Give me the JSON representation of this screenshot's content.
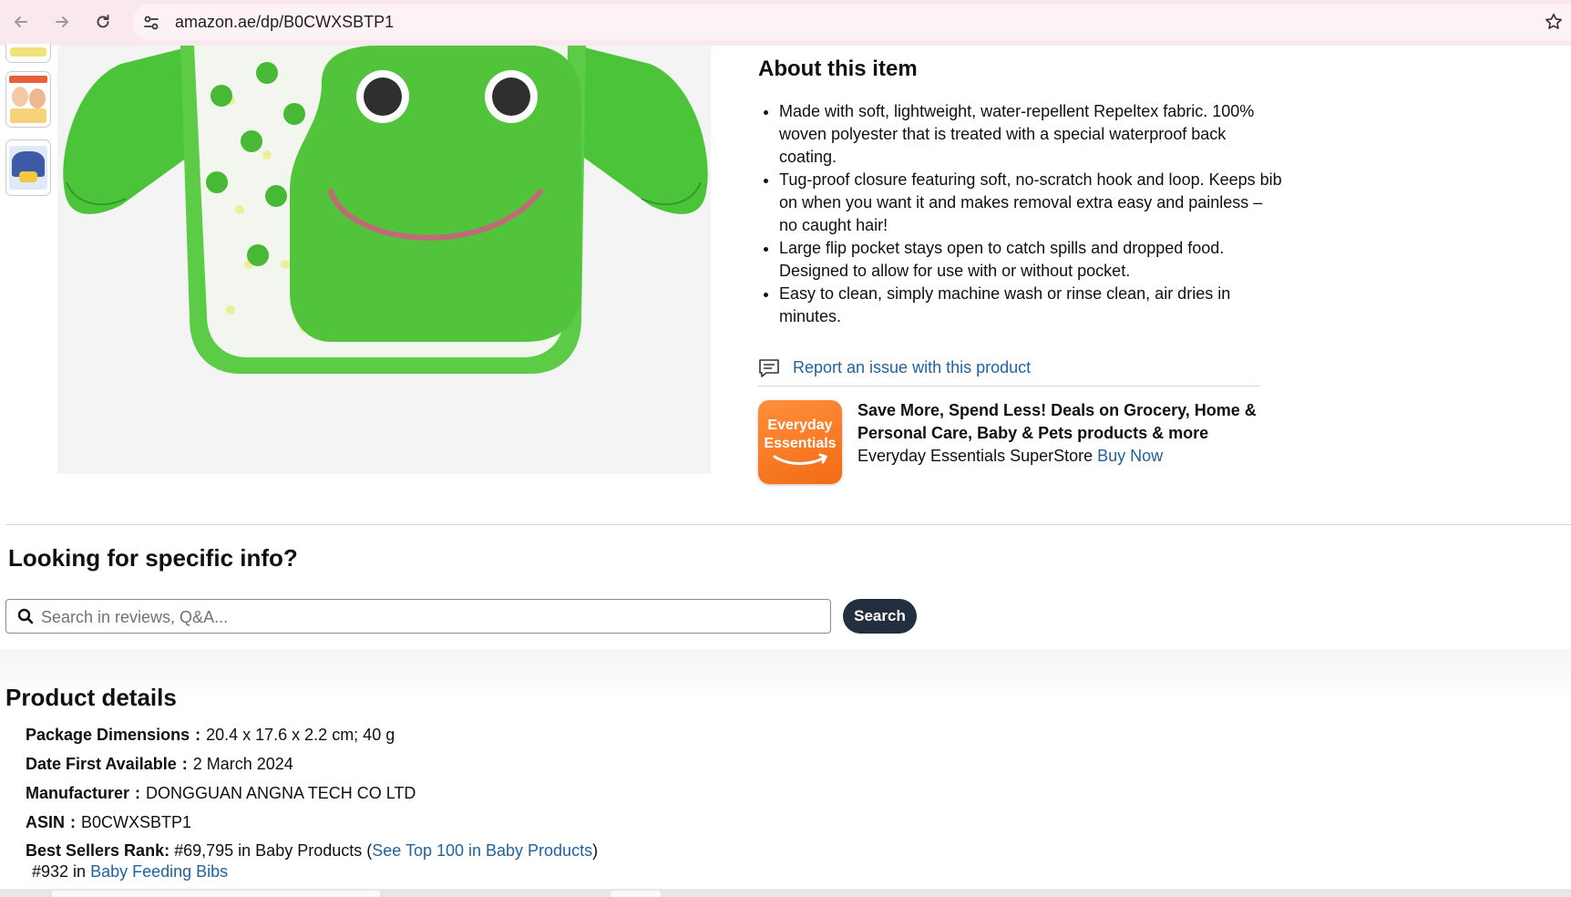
{
  "browser": {
    "url": "amazon.ae/dp/B0CWXSBTP1"
  },
  "gallery": {
    "thumbnails": [
      "thumbnail-bib-top",
      "thumbnail-baby-eating",
      "thumbnail-bib-pattern"
    ]
  },
  "about": {
    "title": "About this item",
    "bullets": [
      "Made with soft, lightweight, water-repellent Repeltex fabric. 100% woven polyester that is treated with a special waterproof back coating.",
      "Tug-proof closure featuring soft, no-scratch hook and loop. Keeps bib on when you want it and makes removal extra easy and painless – no caught hair!",
      "Large flip pocket stays open to catch spills and dropped food. Designed to allow for use with or without pocket.",
      "Easy to clean, simply machine wash or rinse clean, air dries in minutes."
    ],
    "report_link": "Report an issue with this product"
  },
  "promo": {
    "badge_line1": "Everyday",
    "badge_line2": "Essentials",
    "headline": "Save More, Spend Less! Deals on Grocery, Home & Personal Care, Baby & Pets products & more",
    "store": "Everyday Essentials SuperStore",
    "cta": "Buy Now",
    "badge_color": "#f47a26"
  },
  "search_section": {
    "title": "Looking for specific info?",
    "placeholder": "Search in reviews, Q&A...",
    "button": "Search"
  },
  "details": {
    "title": "Product details",
    "rows": [
      {
        "label": "Package Dimensions",
        "value": "20.4 x 17.6 x 2.2 cm; 40 g"
      },
      {
        "label": "Date First Available",
        "value": "2 March 2024"
      },
      {
        "label": "Manufacturer",
        "value": "DONGGUAN ANGNA TECH CO LTD"
      },
      {
        "label": "ASIN",
        "value": "B0CWXSBTP1"
      }
    ],
    "rank": {
      "label": "Best Sellers Rank:",
      "value": "#69,795 in Baby Products (",
      "link": "See Top 100 in Baby Products",
      "close": ")",
      "sub_value": "#932 in",
      "sub_link": "Baby Feeding Bibs"
    },
    "separator": ":"
  }
}
